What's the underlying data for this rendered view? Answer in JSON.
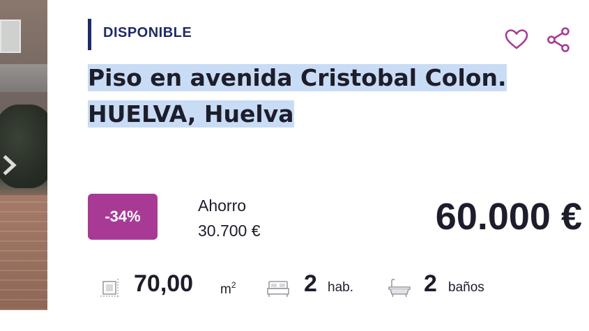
{
  "status": {
    "label": "DISPONIBLE",
    "color": "#1f2a6b"
  },
  "actions": {
    "favorite_icon": "heart-icon",
    "share_icon": "share-icon",
    "accent_color": "#a83a96"
  },
  "listing": {
    "title_line1": "Piso en avenida Cristobal Colon.",
    "title_line2": "HUELVA, Huelva",
    "title_selected": true
  },
  "pricing": {
    "discount": "-34%",
    "discount_color": "#a83a96",
    "savings_label": "Ahorro",
    "savings_value": "30.700 €",
    "price": "60.000 €"
  },
  "features": {
    "area_value": "70,00",
    "area_unit": "m",
    "area_unit_sup": "2",
    "rooms_value": "2",
    "rooms_unit": "hab.",
    "baths_value": "2",
    "baths_unit": "baños"
  },
  "gallery": {
    "next_icon": "chevron-right-icon"
  }
}
